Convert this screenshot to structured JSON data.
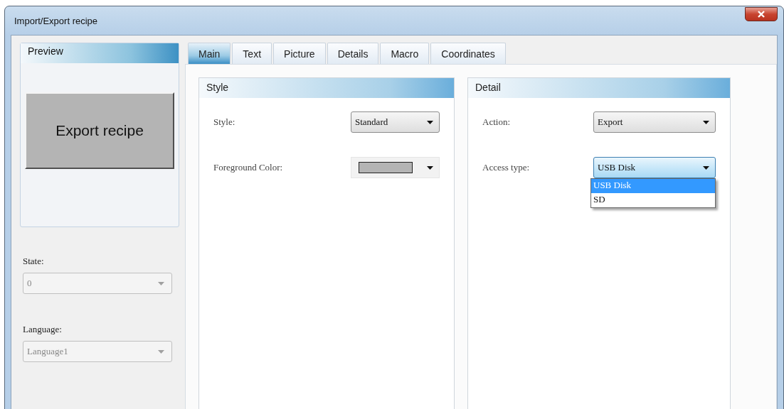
{
  "window": {
    "title": "Import/Export recipe"
  },
  "preview": {
    "title": "Preview",
    "button": "Export recipe"
  },
  "state": {
    "label": "State:",
    "value": "0",
    "disabled": true
  },
  "language": {
    "label": "Language:",
    "value": "Language1",
    "disabled": true
  },
  "tabs": [
    {
      "label": "Main",
      "selected": true
    },
    {
      "label": "Text",
      "selected": false
    },
    {
      "label": "Picture",
      "selected": false
    },
    {
      "label": "Details",
      "selected": false
    },
    {
      "label": "Macro",
      "selected": false
    },
    {
      "label": "Coordinates",
      "selected": false
    }
  ],
  "style_group": {
    "title": "Style",
    "fields": [
      {
        "kind": "dropdown",
        "label": "Style:",
        "value": "Standard",
        "focused": false
      },
      {
        "kind": "color",
        "label": "Foreground Color:",
        "color": "#b4b4b4"
      }
    ]
  },
  "detail_group": {
    "title": "Detail",
    "fields": [
      {
        "kind": "dropdown",
        "label": "Action:",
        "value": "Export",
        "focused": false
      },
      {
        "kind": "dropdown",
        "label": "Access type:",
        "value": "USB Disk",
        "focused": true,
        "options": [
          {
            "label": "USB Disk",
            "selected": true
          },
          {
            "label": "SD",
            "selected": false
          }
        ]
      }
    ]
  }
}
